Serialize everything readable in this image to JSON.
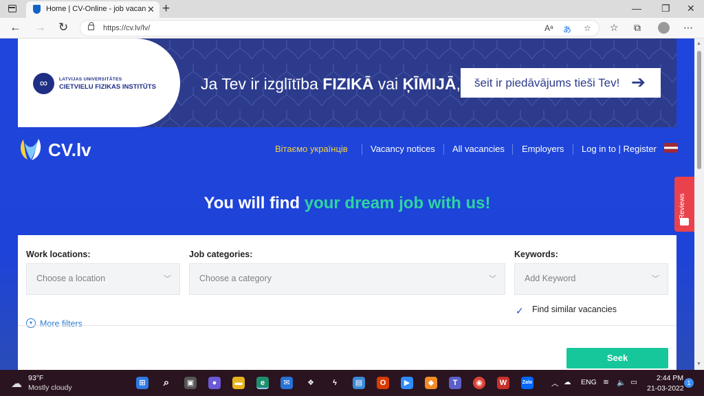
{
  "browser": {
    "tab_title": "Home | CV-Online - job vacancies",
    "url": "https://cv.lv/lv/"
  },
  "banner": {
    "university_line1": "LATVIJAS UNIVERSITĀTES",
    "university_line2": "CIETVIELU FIZIKAS INSTITŪTS",
    "text_pre": "Ja Tev ir izglītība",
    "text_bold1": "FIZIKĀ",
    "text_mid": "vai",
    "text_bold2": "ĶĪMIJĀ",
    "text_post": ",",
    "cta": "šeit ir piedāvājums tieši Tev!"
  },
  "header": {
    "logo": "CV.lv",
    "nav": [
      {
        "label": "Вітаємо українців",
        "highlight": true
      },
      {
        "label": "Vacancy notices"
      },
      {
        "label": "All vacancies"
      },
      {
        "label": "Employers"
      },
      {
        "label": "Log in to | Register"
      }
    ]
  },
  "hero": {
    "part1": "You will find",
    "part2": "your dream job with us!"
  },
  "reviews_label": "Reviews",
  "search": {
    "locations_label": "Work locations:",
    "locations_placeholder": "Choose a location",
    "categories_label": "Job categories:",
    "categories_placeholder": "Choose a category",
    "keywords_label": "Keywords:",
    "keywords_placeholder": "Add Keyword",
    "similar_label": "Find similar vacancies",
    "similar_checked": true,
    "more_filters": "More filters",
    "seek_label": "Seek"
  },
  "taskbar": {
    "temperature": "93°F",
    "condition": "Mostly cloudy",
    "language": "ENG",
    "time": "2:44 PM",
    "date": "21-03-2022",
    "notifications": "1"
  },
  "colors": {
    "page_blue": "#1f45dc",
    "banner_navy": "#2c3b8c",
    "accent_green": "#2fd4a2",
    "seek_green": "#15c79a",
    "highlight_yellow": "#f4d23c",
    "reviews_red": "#e9424d"
  }
}
